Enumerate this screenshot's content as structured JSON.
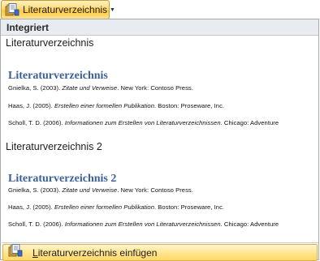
{
  "ribbon": {
    "button_label": "Literaturverzeichnis",
    "button_icon": "bibliography-book-icon",
    "caret_icon": "dropdown-caret-icon"
  },
  "gallery": {
    "section_header": "Integriert",
    "items": [
      {
        "title": "Literaturverzeichnis",
        "preview_heading": "Literaturverzeichnis",
        "entries": [
          {
            "normal": "Gnielka, S. (2003). ",
            "italic": "Zitate und Verweise",
            "rest": ". New York: Contoso Press."
          },
          {
            "normal": "Haas, J. (2005). ",
            "italic": "Erstellen einer formellen Publikation",
            "rest": ". Boston: Proseware, Inc."
          },
          {
            "normal": "Scholl, T. D. (2006). ",
            "italic": "Informationen zum Erstellen von Literaturverzeichnissen",
            "rest": ". Chicago: Adventure"
          }
        ]
      },
      {
        "title": "Literaturverzeichnis 2",
        "preview_heading": "Literaturverzeichnis 2",
        "entries": [
          {
            "normal": "Gnielka, S. (2003). ",
            "italic": "Zitate und Verweise",
            "rest": ". New York: Contoso Press."
          },
          {
            "normal": "Haas, J. (2005). ",
            "italic": "Erstellen einer formellen Publikation",
            "rest": ". Boston: Proseware, Inc."
          },
          {
            "normal": "Scholl, T. D. (2006). ",
            "italic": "Informationen zum Erstellen von Literaturverzeichnissen",
            "rest": ". Chicago: Adventure"
          }
        ]
      }
    ]
  },
  "footer": {
    "insert_label_accel": "L",
    "insert_label_rest": "iteraturverzeichnis einfügen",
    "insert_icon": "insert-bibliography-icon"
  },
  "colors": {
    "accent_button": "#ffd869",
    "preview_heading": "#3a5f9b",
    "header_bg": "#e8ebef"
  }
}
